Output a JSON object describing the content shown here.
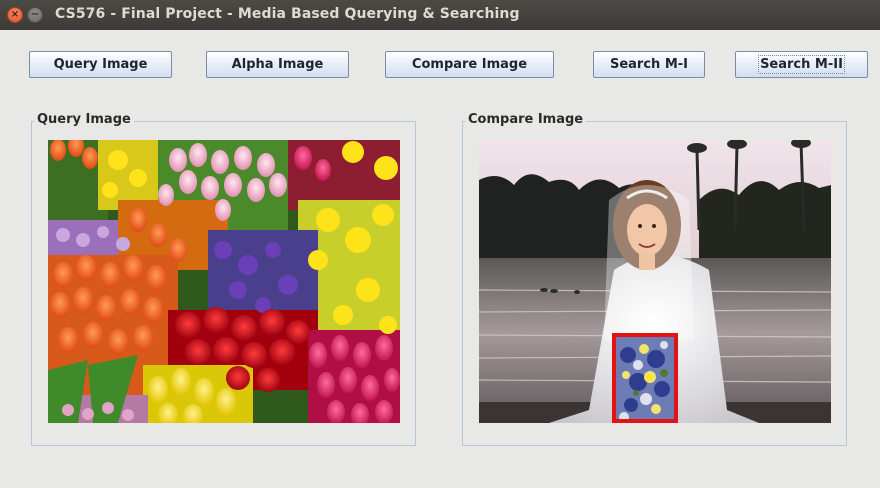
{
  "window": {
    "title": "CS576 - Final Project - Media Based Querying & Searching",
    "close_glyph": "×",
    "minimize_glyph": "−"
  },
  "toolbar": {
    "query_image": "Query Image",
    "alpha_image": "Alpha Image",
    "compare_image": "Compare Image",
    "search_m1": "Search M-I",
    "search_m2": "Search M-II"
  },
  "panels": {
    "query": {
      "title": "Query Image"
    },
    "compare": {
      "title": "Compare Image"
    }
  },
  "colors": {
    "match_box": "#e31313",
    "panel_border": "#b7c7d8"
  }
}
